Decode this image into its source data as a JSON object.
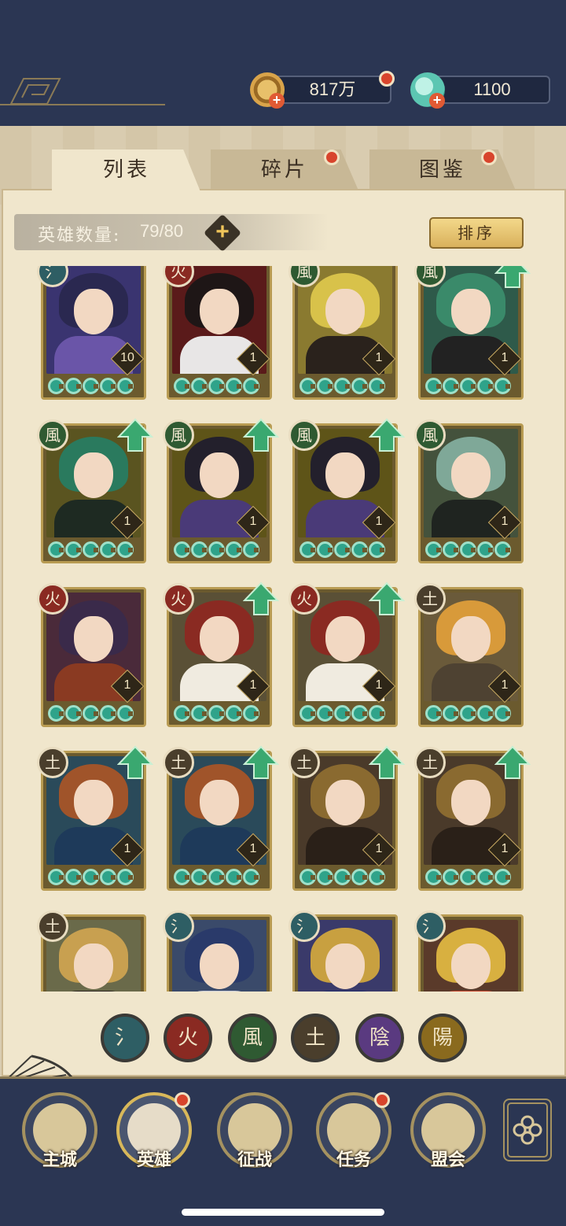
{
  "currency": {
    "coins": "817万",
    "jade": "1100"
  },
  "tabs": [
    {
      "label": "列表",
      "active": true,
      "dot": false
    },
    {
      "label": "碎片",
      "active": false,
      "dot": true
    },
    {
      "label": "图鉴",
      "active": false,
      "dot": true
    }
  ],
  "hero_count": {
    "label": "英雄数量:",
    "value": "79/80"
  },
  "sort_label": "排序",
  "elements": {
    "water": {
      "glyph": "氵",
      "color": "#2e5e64"
    },
    "fire": {
      "glyph": "火",
      "color": "#8a2a22"
    },
    "wind": {
      "glyph": "風",
      "color": "#2f5a32"
    },
    "earth": {
      "glyph": "土",
      "color": "#4a3e2c"
    },
    "yin": {
      "glyph": "陰",
      "color": "#5a3a80"
    },
    "yang": {
      "glyph": "陽",
      "color": "#8a6a1e"
    }
  },
  "heroes": [
    {
      "element": "water",
      "level": "10",
      "upgrade": false
    },
    {
      "element": "fire",
      "level": "1",
      "upgrade": false
    },
    {
      "element": "wind",
      "level": "1",
      "upgrade": false
    },
    {
      "element": "wind",
      "level": "1",
      "upgrade": true
    },
    {
      "element": "wind",
      "level": "1",
      "upgrade": true
    },
    {
      "element": "wind",
      "level": "1",
      "upgrade": true
    },
    {
      "element": "wind",
      "level": "1",
      "upgrade": true
    },
    {
      "element": "wind",
      "level": "1",
      "upgrade": false
    },
    {
      "element": "fire",
      "level": "1",
      "upgrade": false
    },
    {
      "element": "fire",
      "level": "1",
      "upgrade": true
    },
    {
      "element": "fire",
      "level": "1",
      "upgrade": true
    },
    {
      "element": "earth",
      "level": "1",
      "upgrade": false
    },
    {
      "element": "earth",
      "level": "1",
      "upgrade": true
    },
    {
      "element": "earth",
      "level": "1",
      "upgrade": true
    },
    {
      "element": "earth",
      "level": "1",
      "upgrade": true
    },
    {
      "element": "earth",
      "level": "1",
      "upgrade": true
    },
    {
      "element": "earth",
      "level": "",
      "upgrade": false
    },
    {
      "element": "water",
      "level": "",
      "upgrade": false
    },
    {
      "element": "water",
      "level": "",
      "upgrade": false
    },
    {
      "element": "water",
      "level": "",
      "upgrade": false
    }
  ],
  "filters": [
    "water",
    "fire",
    "wind",
    "earth",
    "yin",
    "yang"
  ],
  "nav": [
    {
      "label": "主城",
      "icon": "castle-icon",
      "dot": false
    },
    {
      "label": "英雄",
      "icon": "hero-portrait-icon",
      "dot": true
    },
    {
      "label": "征战",
      "icon": "battle-icon",
      "dot": false
    },
    {
      "label": "任务",
      "icon": "task-scroll-icon",
      "dot": true
    },
    {
      "label": "盟会",
      "icon": "alliance-hall-icon",
      "dot": false
    }
  ]
}
